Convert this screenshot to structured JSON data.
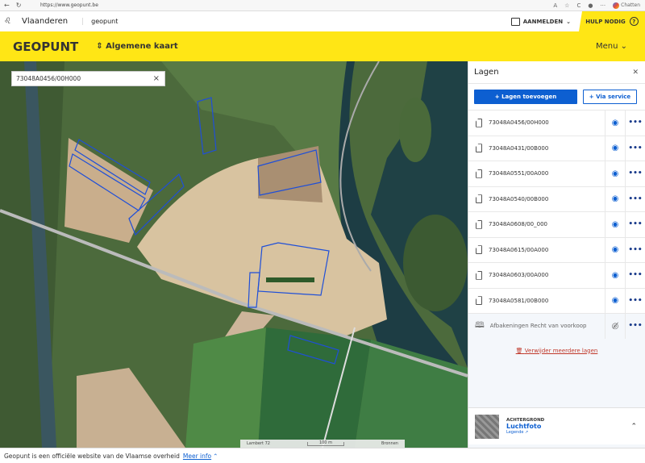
{
  "browser": {
    "url": "https://www.geopunt.be",
    "chat_label": "Chatten"
  },
  "header": {
    "org": "Vlaanderen",
    "site": "geopunt",
    "login": "AANMELDEN",
    "help": "HULP NODIG"
  },
  "appbar": {
    "brand": "GEOPUNT",
    "map_selector": "Algemene kaart",
    "menu": "Menu"
  },
  "search": {
    "value": "73048A0456/00H000"
  },
  "scale": {
    "projection": "Lambert 72",
    "distance": "100 m",
    "sources": "Bronnen"
  },
  "panel": {
    "title": "Lagen",
    "add_button": "+ Lagen toevoegen",
    "service_button": "+ Via service",
    "layers": [
      {
        "label": "73048A0456/00H000",
        "visible": true
      },
      {
        "label": "73048A0431/00B000",
        "visible": true
      },
      {
        "label": "73048A0551/00A000",
        "visible": true
      },
      {
        "label": "73048A0540/00B000",
        "visible": true
      },
      {
        "label": "73048A0608/00_000",
        "visible": true
      },
      {
        "label": "73048A0615/00A000",
        "visible": true
      },
      {
        "label": "73048A0603/00A000",
        "visible": true
      },
      {
        "label": "73048A0581/00B000",
        "visible": true
      }
    ],
    "extra_layer": {
      "label": "Afbakeningen Recht van voorkoop",
      "visible": false
    },
    "delete_link": "Verwijder meerdere lagen",
    "background": {
      "caption": "ACHTERGROND",
      "name": "Luchtfoto",
      "legend": "Legende"
    }
  },
  "footer": {
    "text": "Geopunt is een officiële website van de Vlaamse overheid",
    "link": "Meer info"
  },
  "colors": {
    "accent_yellow": "#ffe615",
    "primary_blue": "#0d5fd1",
    "parcel_outline": "#1f4fd8",
    "delete_red": "#c0392b"
  }
}
